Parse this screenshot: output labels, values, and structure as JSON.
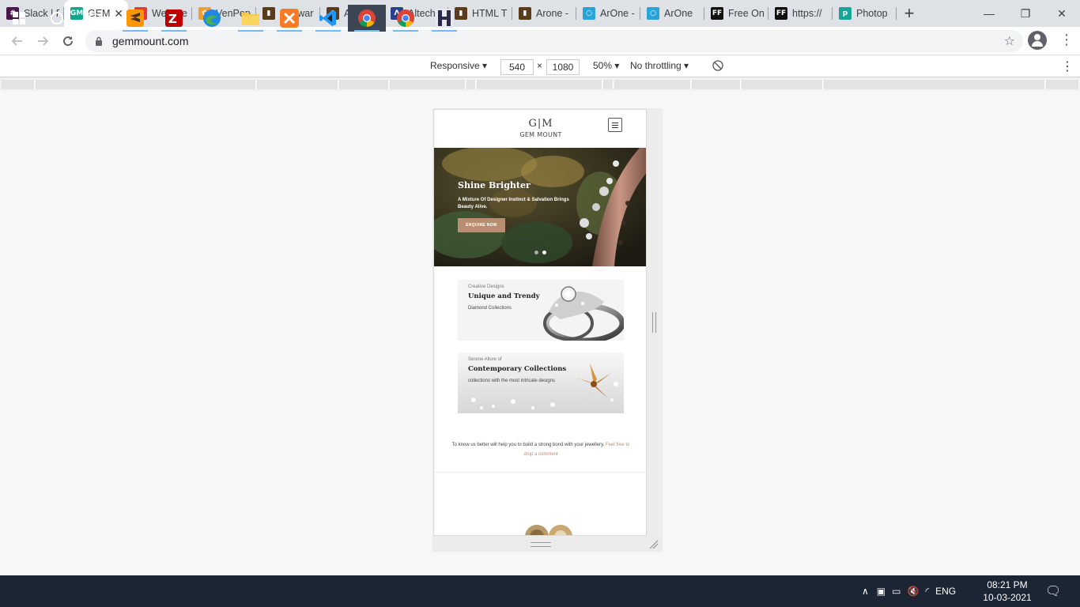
{
  "browser": {
    "tabs": [
      {
        "label": "Slack | P",
        "icon": "slack-icon",
        "color": "#4a154b",
        "glyph": "#"
      },
      {
        "label": "GEM",
        "icon": "gemmount-icon",
        "color": "#14a58e",
        "glyph": "GM",
        "active": true
      },
      {
        "label": "Web De",
        "icon": "feather-icon",
        "color": "#e53935",
        "glyph": "✦"
      },
      {
        "label": "VenPep",
        "icon": "venpep-icon",
        "color": "#f0a030",
        "glyph": "✿"
      },
      {
        "label": "Softwar",
        "icon": "site-icon",
        "color": "#5a3b1c",
        "glyph": "▮"
      },
      {
        "label": "Altech |",
        "icon": "site-icon",
        "color": "#5a3b1c",
        "glyph": "▮"
      },
      {
        "label": "Altech -",
        "icon": "altech-icon",
        "color": "#2a3f8f",
        "glyph": "Λ"
      },
      {
        "label": "HTML T",
        "icon": "site-icon",
        "color": "#5a3b1c",
        "glyph": "▮"
      },
      {
        "label": "Arone -",
        "icon": "site-icon",
        "color": "#5a3b1c",
        "glyph": "▮"
      },
      {
        "label": "ArOne -",
        "icon": "arone-icon",
        "color": "#29a3d9",
        "glyph": "○"
      },
      {
        "label": "ArOne",
        "icon": "arone-icon",
        "color": "#29a3d9",
        "glyph": "○"
      },
      {
        "label": "Free On",
        "icon": "ff-icon",
        "color": "#111111",
        "glyph": "FF"
      },
      {
        "label": "https://",
        "icon": "ff-icon",
        "color": "#111111",
        "glyph": "FF"
      },
      {
        "label": "Photop",
        "icon": "photopea-icon",
        "color": "#18a497",
        "glyph": "p"
      }
    ],
    "new_tab": "+",
    "window_controls": {
      "minimize": "—",
      "restore": "❐",
      "close": "✕"
    },
    "url": "gemmount.com"
  },
  "devtools": {
    "device": "Responsive",
    "width": "540",
    "height": "1080",
    "times": "×",
    "zoom": "50%",
    "throttling": "No throttling"
  },
  "site": {
    "logo_mark": "G|M",
    "logo_name": "GEM MOUNT",
    "hero": {
      "title": "Shine Brighter",
      "subtitle": "A Mixture Of Designer Instinct & Salvation Brings Beauty Alive.",
      "button": "ENQUIRE NOW",
      "slides": 2,
      "active_slide": 1
    },
    "cards": [
      {
        "kicker": "Creative Designs",
        "title": "Unique and Trendy",
        "subtitle": "Diamond Collections"
      },
      {
        "kicker": "Serene Allure of",
        "title": "Contemporary Collections",
        "subtitle": "collections with the most intricate designs"
      }
    ],
    "about_text": "To know us better will help you to build a strong bond with your jewellery.",
    "about_link": "Feel free to drop a comment"
  },
  "taskbar": {
    "apps": [
      "start-button",
      "search-button",
      "task-view-button",
      "sublime-text-icon",
      "filezilla-icon",
      "edge-icon",
      "file-explorer-icon",
      "xampp-icon",
      "vscode-icon",
      "chrome-icon",
      "chrome-icon",
      "app-icon"
    ],
    "language": "ENG",
    "time": "08:21 PM",
    "date": "10-03-2021"
  }
}
